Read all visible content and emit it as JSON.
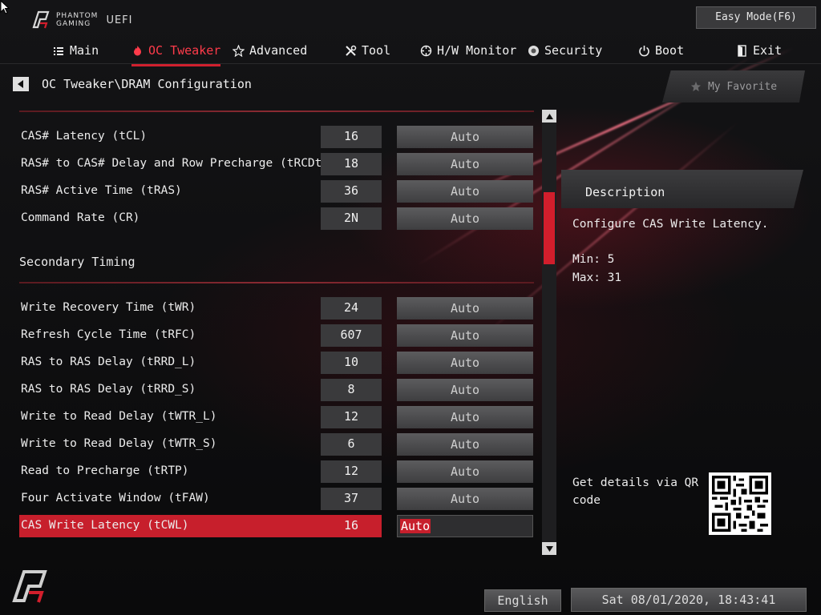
{
  "brand": {
    "line1": "PHANTOM",
    "line2": "GAMING",
    "uefi": "UEFI"
  },
  "easy_mode_label": "Easy Mode(F6)",
  "nav": [
    {
      "label": "Main",
      "icon": "list-icon"
    },
    {
      "label": "OC Tweaker",
      "icon": "flame-icon",
      "active": true
    },
    {
      "label": "Advanced",
      "icon": "star-icon"
    },
    {
      "label": "Tool",
      "icon": "tools-icon"
    },
    {
      "label": "H/W Monitor",
      "icon": "crosshair-icon"
    },
    {
      "label": "Security",
      "icon": "shield-icon"
    },
    {
      "label": "Boot",
      "icon": "power-icon"
    },
    {
      "label": "Exit",
      "icon": "exit-door-icon"
    }
  ],
  "breadcrumb": "OC Tweaker\\DRAM Configuration",
  "favorite_label": "My Favorite",
  "rows": [
    {
      "label": "CAS# Latency (tCL)",
      "value": "16",
      "option": "Auto"
    },
    {
      "label": "RAS# to CAS# Delay and Row Precharge (tRCDtRP)",
      "value": "18",
      "option": "Auto"
    },
    {
      "label": "RAS# Active Time (tRAS)",
      "value": "36",
      "option": "Auto"
    },
    {
      "label": "Command Rate (CR)",
      "value": "2N",
      "option": "Auto"
    },
    {
      "label": "Write Recovery Time (tWR)",
      "value": "24",
      "option": "Auto"
    },
    {
      "label": "Refresh Cycle Time (tRFC)",
      "value": "607",
      "option": "Auto"
    },
    {
      "label": "RAS to RAS Delay (tRRD_L)",
      "value": "10",
      "option": "Auto"
    },
    {
      "label": "RAS to RAS Delay (tRRD_S)",
      "value": "8",
      "option": "Auto"
    },
    {
      "label": "Write to Read Delay (tWTR_L)",
      "value": "12",
      "option": "Auto"
    },
    {
      "label": "Write to Read Delay (tWTR_S)",
      "value": "6",
      "option": "Auto"
    },
    {
      "label": "Read to Precharge (tRTP)",
      "value": "12",
      "option": "Auto"
    },
    {
      "label": "Four Activate Window (tFAW)",
      "value": "37",
      "option": "Auto"
    },
    {
      "label": "CAS Write Latency (tCWL)",
      "value": "16",
      "option": "Auto",
      "selected": true
    }
  ],
  "section_title": "Secondary Timing",
  "description": {
    "title": "Description",
    "text": "Configure CAS Write Latency.",
    "min": "Min: 5",
    "max": "Max: 31"
  },
  "qr_label": "Get details via QR code",
  "language": "English",
  "datetime": "Sat 08/01/2020, 18:43:41",
  "colors": {
    "accent": "#c71f2c",
    "active_tab": "#ff3b4a",
    "scroll_thumb": "#d21e2c"
  }
}
